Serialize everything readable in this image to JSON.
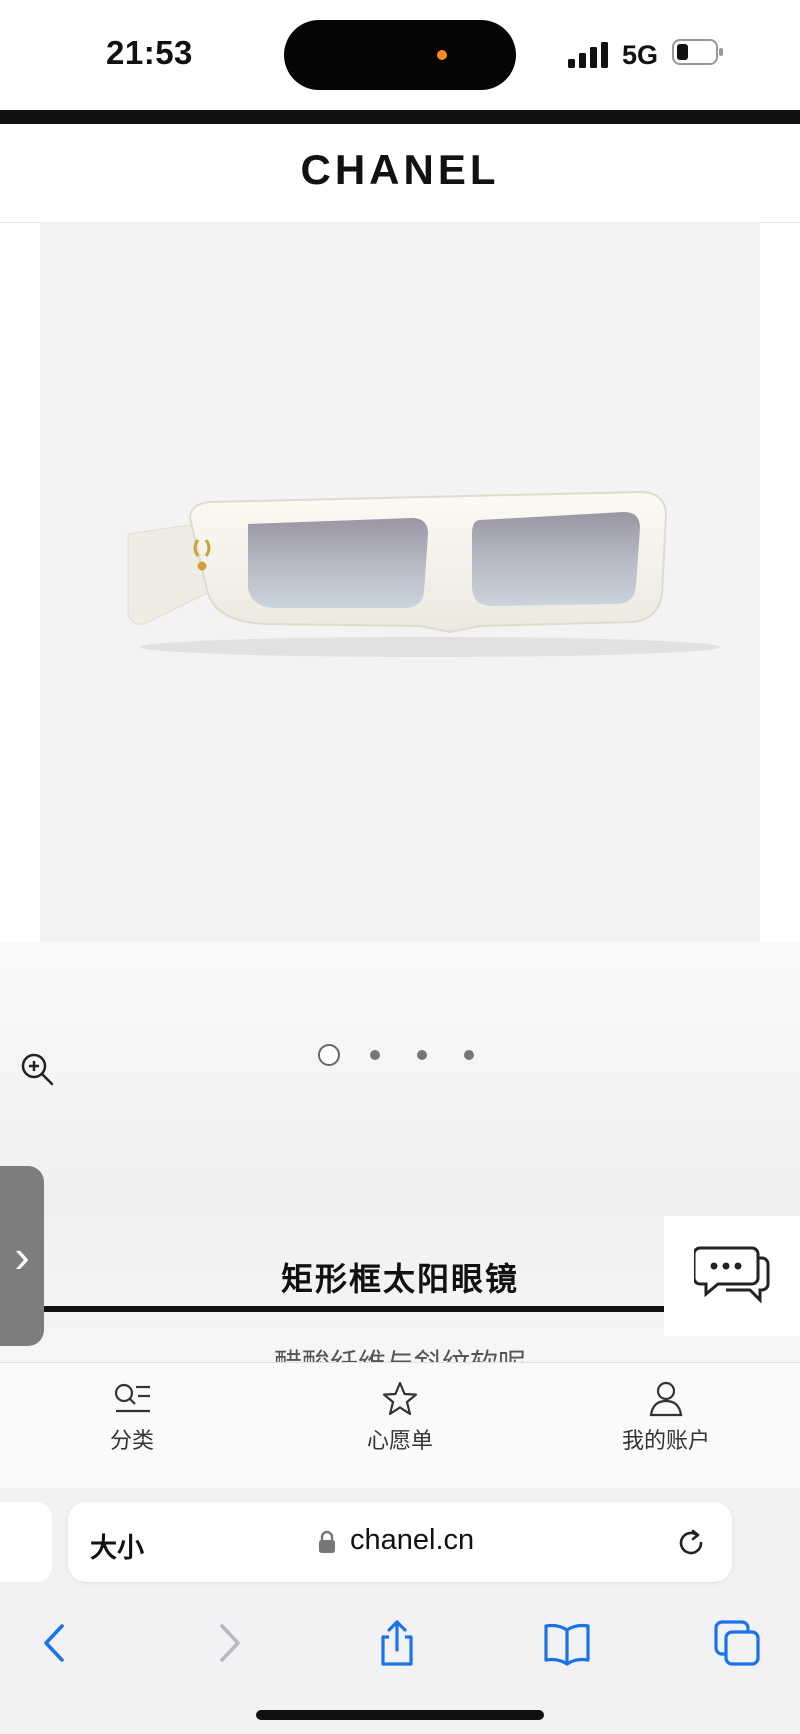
{
  "status_bar": {
    "time": "21:53",
    "network": "5G",
    "accent_dot_color": "#ff8a1c"
  },
  "header": {
    "brand": "CHANEL"
  },
  "product": {
    "image_icon": "sunglasses-image",
    "carousel": {
      "count": 4,
      "active_index": 0
    },
    "title": "矩形框太阳眼镜",
    "subtitle": "醋酸纤维与斜纹软呢"
  },
  "side_tab": {
    "chevron": "›"
  },
  "bottom_nav": {
    "items": [
      {
        "label": "分类",
        "icon": "category-list-icon"
      },
      {
        "label": "心愿单",
        "icon": "star-icon"
      },
      {
        "label": "我的账户",
        "icon": "user-icon"
      }
    ]
  },
  "browser": {
    "text_size_label": "大小",
    "url": "chanel.cn",
    "accent_color": "#1a73e8"
  }
}
